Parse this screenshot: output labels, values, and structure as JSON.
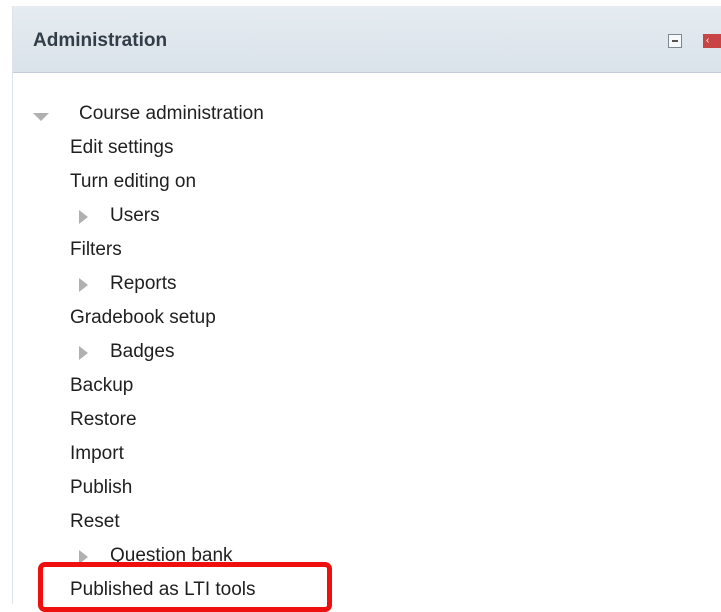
{
  "block": {
    "title": "Administration",
    "controls": {
      "minimize_icon": "minus-box-icon",
      "dock_icon": "dock-left-icon",
      "dock_glyph": "‹",
      "dock_color": "#c94545"
    }
  },
  "tree": {
    "course_admin": "Course administration",
    "items": {
      "edit_settings": "Edit settings",
      "turn_editing_on": "Turn editing on",
      "users": "Users",
      "filters": "Filters",
      "reports": "Reports",
      "gradebook_setup": "Gradebook setup",
      "badges": "Badges",
      "backup": "Backup",
      "restore": "Restore",
      "import": "Import",
      "publish": "Publish",
      "reset": "Reset",
      "question_bank": "Question bank",
      "published_lti": "Published as LTI tools"
    }
  },
  "highlight_color": "#ee0f0f"
}
